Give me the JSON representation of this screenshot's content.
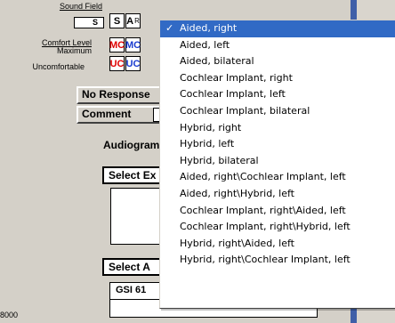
{
  "form": {
    "sound_field_label": "Sound Field",
    "comfort_level_label": "Comfort Level",
    "maximum_label": "Maximum",
    "uncomfortable_label": "Uncomfortable",
    "row1": {
      "s_box": "S",
      "s": "S",
      "a": "A",
      "r": "R"
    },
    "row2": {
      "mc1": "MC",
      "mc2": "MC"
    },
    "row3": {
      "uc1": "UC",
      "uc2": "UC"
    },
    "no_response_button": "No Response",
    "comment_button": "Comment",
    "audiogram_heading": "Audiogram",
    "select_ex_button": "Select Ex",
    "select_a_button": "Select A",
    "gsi_value": "GSI 61",
    "bottom_axis_label": "8000"
  },
  "dropdown": {
    "selected_index": 0,
    "options": [
      "Aided, right",
      "Aided, left",
      "Aided, bilateral",
      "Cochlear Implant, right",
      "Cochlear Implant, left",
      "Cochlear Implant, bilateral",
      "Hybrid, right",
      "Hybrid, left",
      "Hybrid, bilateral",
      "Aided, right\\Cochlear Implant, left",
      "Aided, right\\Hybrid, left",
      "Cochlear Implant, right\\Aided, left",
      "Cochlear Implant, right\\Hybrid, left",
      "Hybrid, right\\Aided, left",
      "Hybrid, right\\Cochlear Implant, left"
    ],
    "check_glyph": "✓"
  },
  "colors": {
    "uncomfortable_red": "#e00000",
    "comfort_blue": "#1a3ccf",
    "selection_blue": "#316ac5"
  }
}
